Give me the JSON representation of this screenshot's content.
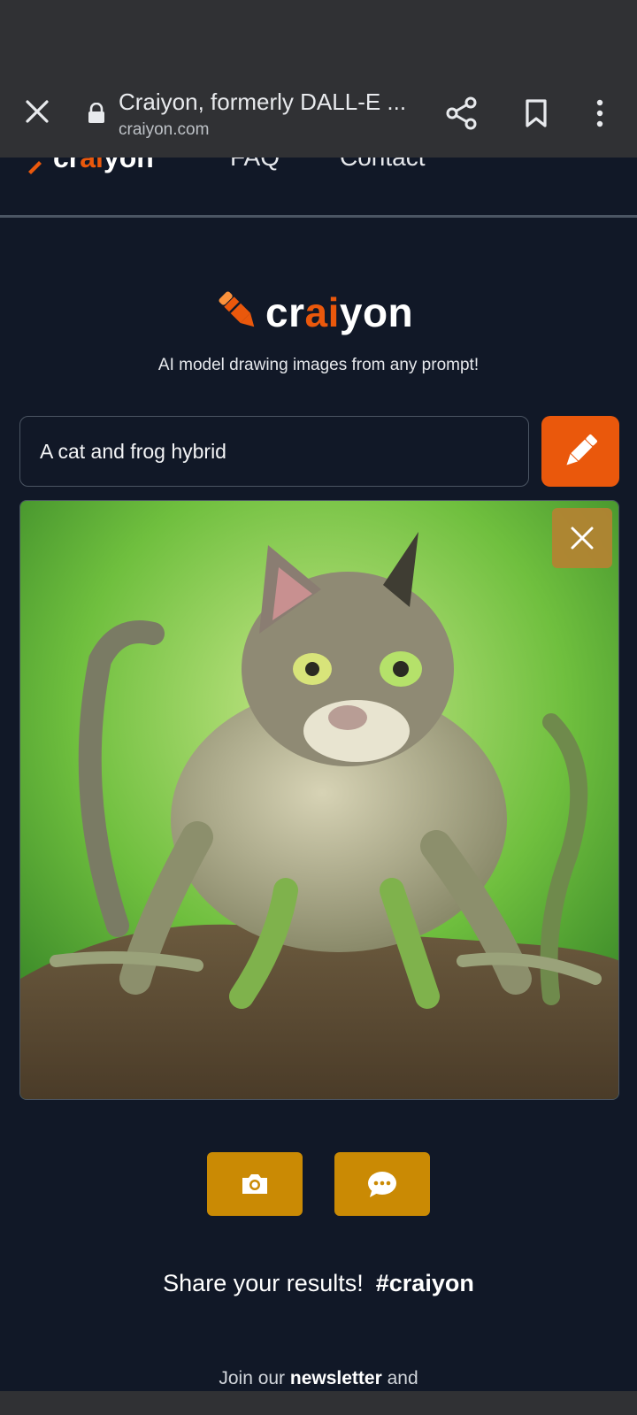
{
  "browser": {
    "title": "Craiyon, formerly DALL-E ...",
    "url": "craiyon.com",
    "icons": [
      "close-icon",
      "lock-icon",
      "share-icon",
      "bookmark-icon",
      "more-vert-icon"
    ]
  },
  "site_nav": {
    "brand_pre": "cr",
    "brand_ai": "ai",
    "brand_post": "yon",
    "links": [
      "FAQ",
      "Contact"
    ]
  },
  "hero": {
    "wordmark_pre": "cr",
    "wordmark_ai": "ai",
    "wordmark_post": "yon",
    "tagline": "AI model drawing images from any prompt!"
  },
  "prompt": {
    "value": "A cat and frog hybrid",
    "draw_icon": "pencil-icon"
  },
  "result": {
    "dismiss_icon": "close-icon",
    "image_icon": "generated-image"
  },
  "actions": {
    "screenshot_icon": "camera-icon",
    "feedback_icon": "chat-bubble-icon"
  },
  "footer": {
    "share_text": "Share your results!",
    "hashtag": "#craiyon",
    "newsletter_pre": "Join our ",
    "newsletter_bold": "newsletter",
    "newsletter_post": " and"
  },
  "colors": {
    "accent": "#ea580c",
    "background": "#111827",
    "action": "#ca8a04"
  }
}
